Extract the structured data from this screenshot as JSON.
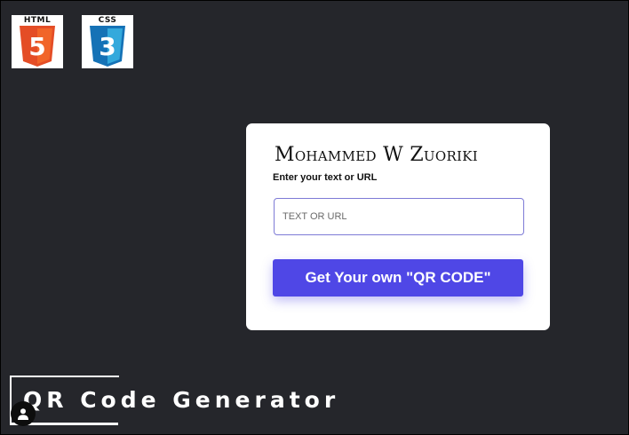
{
  "logos": {
    "html": {
      "word": "HTML",
      "digit": "5",
      "color": "#e44d26",
      "icon": "html5-icon"
    },
    "css": {
      "word": "CSS",
      "digit": "3",
      "color": "#2965f1",
      "icon": "css3-icon"
    }
  },
  "card": {
    "title": "Mohammed W Zuoriki",
    "label": "Enter your text or URL",
    "input_placeholder": "TEXT OR URL",
    "input_value": "",
    "button_label": "Get Your own \"QR CODE\""
  },
  "banner": {
    "title": "QR Code Generator"
  },
  "avatar": {
    "icon": "user-avatar-icon"
  },
  "colors": {
    "background": "#25262b",
    "card": "#ffffff",
    "accent": "#4f47e6",
    "input_border": "#7e7bd6"
  }
}
